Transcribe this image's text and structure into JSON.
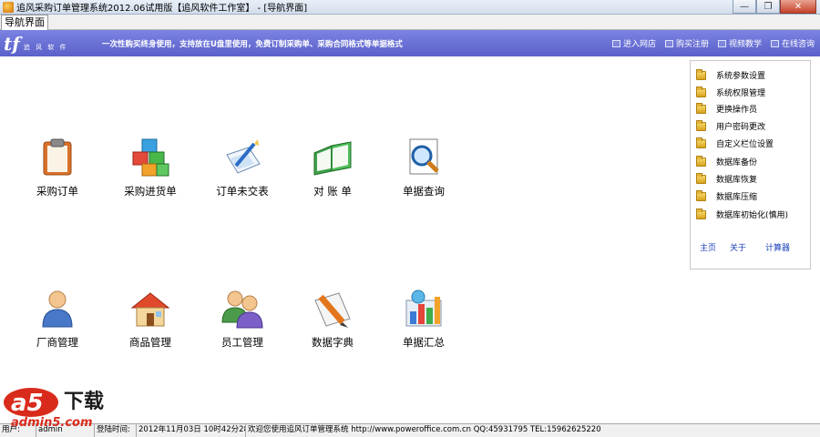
{
  "window": {
    "title": "追风采购订单管理系统2012.06试用版【追风软件工作室】 - [导航界面]",
    "buttons": {
      "minimize": "—",
      "maximize": "❐",
      "close": "✕"
    }
  },
  "tab": {
    "label": "导航界面"
  },
  "banner": {
    "logo_mark": "tf",
    "logo_text": "追 风 软 件",
    "slogan": "一次性购买终身使用，支持放在U盘里使用，免费订制采购单、采购合同格式等单据格式",
    "links": [
      "进入网店",
      "购买注册",
      "视频教学",
      "在线咨询"
    ]
  },
  "main_items": [
    {
      "label": "采购订单",
      "icon": "clipboard-icon"
    },
    {
      "label": "采购进货单",
      "icon": "cubes-icon"
    },
    {
      "label": "订单未交表",
      "icon": "pen-paper-icon"
    },
    {
      "label": "对 账 单",
      "icon": "book-icon"
    },
    {
      "label": "单据查询",
      "icon": "magnifier-icon"
    },
    {
      "label": "厂商管理",
      "icon": "person-icon"
    },
    {
      "label": "商品管理",
      "icon": "house-icon"
    },
    {
      "label": "员工管理",
      "icon": "people-icon"
    },
    {
      "label": "数据字典",
      "icon": "pencil-icon"
    },
    {
      "label": "单据汇总",
      "icon": "bar-chart-icon"
    }
  ],
  "right_panel": {
    "items": [
      "系统参数设置",
      "系统权限管理",
      "更换操作员",
      "用户密码更改",
      "自定义栏位设置",
      "数据库备份",
      "数据库恢复",
      "数据库压缩",
      "数据库初始化(慎用)"
    ],
    "links": {
      "home": "主页",
      "about": "关于",
      "calculator": "计算器"
    }
  },
  "status": {
    "cell1": "用户:",
    "cell2": "admin",
    "cell3": "登陆时间:",
    "datetime": "2012年11月03日 10时42分28秒",
    "message": "欢迎您使用追风订单管理系统 http://www.poweroffice.com.cn QQ:45931795 TEL:15962625220"
  },
  "watermark": {
    "brand": "a5",
    "suffix": "下载",
    "site": "admin5.com"
  }
}
